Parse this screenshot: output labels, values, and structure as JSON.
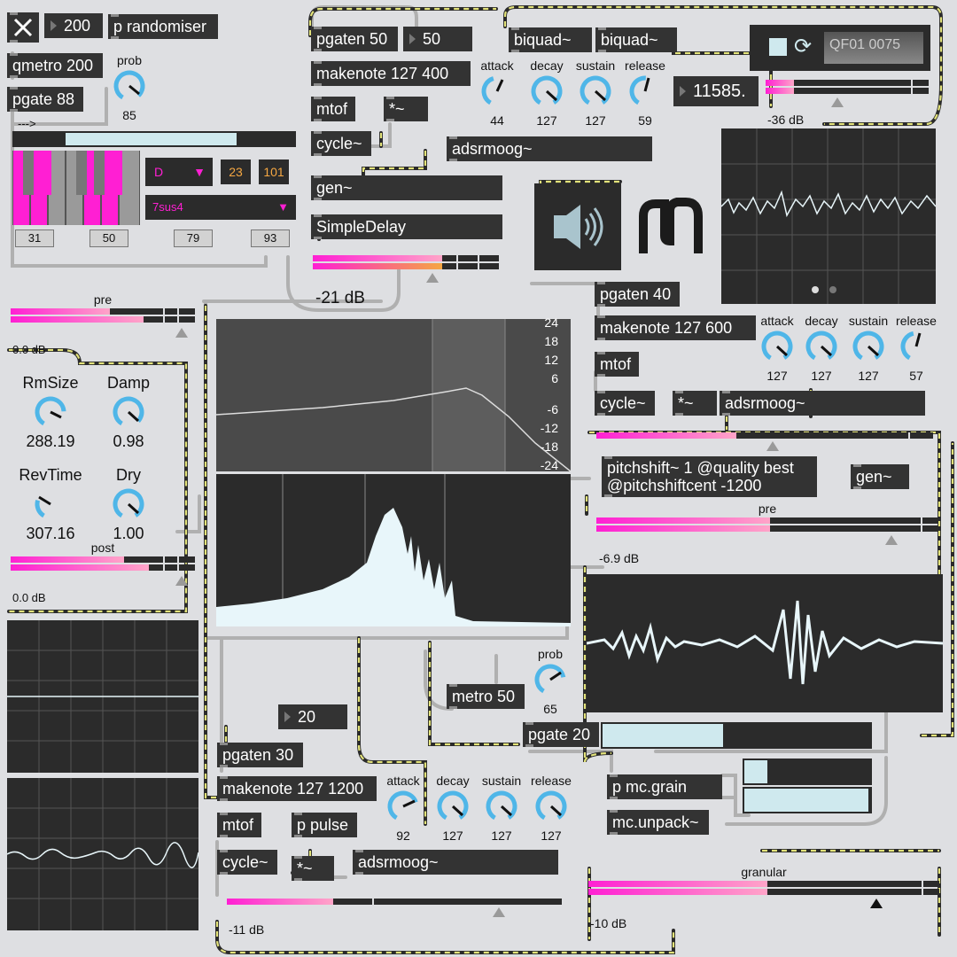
{
  "top_left": {
    "close_icon": "close-x-icon",
    "number_200": "200",
    "randomiser": "p randomiser",
    "qmetro": "qmetro 200",
    "pgate": "pgate 88",
    "prob_label": "prob",
    "prob_value": "85",
    "arrow_text": "--->",
    "keyboard": {
      "note_menu": "D",
      "chord_menu": "7sus4",
      "num_a": "23",
      "num_b": "101",
      "keys": [
        "31",
        "50",
        "79",
        "93"
      ]
    }
  },
  "voice1": {
    "pgaten": "pgaten 50",
    "num_50": "50",
    "makenote": "makenote 127 400",
    "mtof": "mtof",
    "mult": "*~",
    "cycle": "cycle~",
    "adsr": "adsrmoog~",
    "biquad1": "biquad~",
    "biquad2": "biquad~",
    "gen": "gen~",
    "delay": "SimpleDelay",
    "delay_db": "-21 dB",
    "freq_readout": "11585.",
    "dials": [
      {
        "label": "attack",
        "value": "44"
      },
      {
        "label": "decay",
        "value": "127"
      },
      {
        "label": "sustain",
        "value": "127"
      },
      {
        "label": "release",
        "value": "59"
      }
    ]
  },
  "player": {
    "filename": "QF01 0075",
    "level_db": "-36 dB"
  },
  "voice2": {
    "pgaten": "pgaten 40",
    "makenote": "makenote 127 600",
    "mtof": "mtof",
    "cycle": "cycle~",
    "mult": "*~",
    "adsr": "adsrmoog~",
    "dials": [
      {
        "label": "attack",
        "value": "127"
      },
      {
        "label": "decay",
        "value": "127"
      },
      {
        "label": "sustain",
        "value": "127"
      },
      {
        "label": "release",
        "value": "57"
      }
    ],
    "pitchshift": "pitchshift~ 1 @quality best\n@pitchshiftcent -1200",
    "gen": "gen~",
    "pre_label": "pre",
    "db": "-6.9 dB"
  },
  "reverb": {
    "pre_label": "pre",
    "pre_db": "0.0 dB",
    "post_label": "post",
    "post_db": "0.0 dB",
    "dials": [
      {
        "label": "RmSize",
        "value": "288.19"
      },
      {
        "label": "Damp",
        "value": "0.98"
      },
      {
        "label": "RevTime",
        "value": "307.16"
      },
      {
        "label": "Dry",
        "value": "1.00"
      }
    ]
  },
  "filter_graph": {
    "y_ticks": [
      "24",
      "18",
      "12",
      "6",
      "-6",
      "-12",
      "-18",
      "-24"
    ]
  },
  "granular_section": {
    "metro": "metro 50",
    "prob_label": "prob",
    "prob_value": "65",
    "pgate": "pgate 20",
    "grain": "p mc.grain",
    "unpack": "mc.unpack~",
    "label": "granular",
    "db": "-10 dB"
  },
  "voice3": {
    "number_20": "20",
    "pgaten": "pgaten 30",
    "makenote": "makenote 127 1200",
    "mtof": "mtof",
    "pulse": "p pulse",
    "cycle": "cycle~",
    "mult": "*~",
    "adsr": "adsrmoog~",
    "dials": [
      {
        "label": "attack",
        "value": "92"
      },
      {
        "label": "decay",
        "value": "127"
      },
      {
        "label": "sustain",
        "value": "127"
      },
      {
        "label": "release",
        "value": "127"
      }
    ],
    "db": "-11 dB"
  },
  "colors": {
    "accent": "#ff1fd3",
    "dial_blue": "#4fb6e8",
    "object_bg": "#333333",
    "patch_bg": "#dedfe2",
    "scope_line": "#e8f6fa"
  }
}
